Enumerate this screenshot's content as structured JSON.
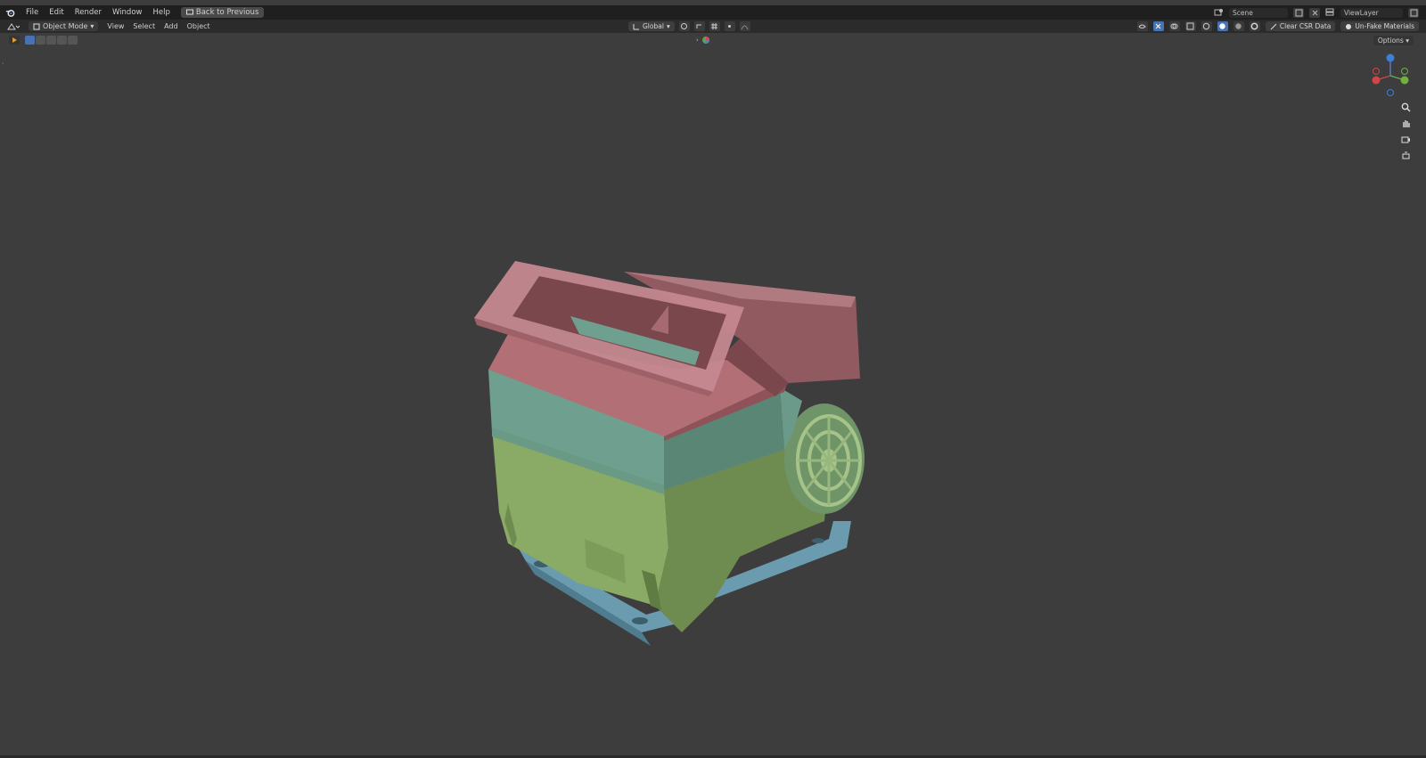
{
  "menubar": {
    "items": [
      "File",
      "Edit",
      "Render",
      "Window",
      "Help"
    ],
    "back_button": "Back to Previous"
  },
  "topright": {
    "scene_label": "Scene",
    "viewlayer_label": "ViewLayer"
  },
  "header": {
    "mode": "Object Mode",
    "menus": [
      "View",
      "Select",
      "Add",
      "Object"
    ],
    "transform_orientation": "Global",
    "clear_cs_btn": "Clear CSR Data",
    "unfake_btn": "Un-Fake Materials"
  },
  "toolbar": {
    "options": "Options"
  },
  "gizmo": {
    "x": "X",
    "y": "Y",
    "z": "Z"
  },
  "colors": {
    "accent": "#4772b3",
    "viewport_bg": "#3d3d3d",
    "mesh_red": "#a06068",
    "mesh_teal": "#6a9a8a",
    "mesh_green": "#7f9f5f",
    "mesh_blue": "#6b9bae"
  }
}
